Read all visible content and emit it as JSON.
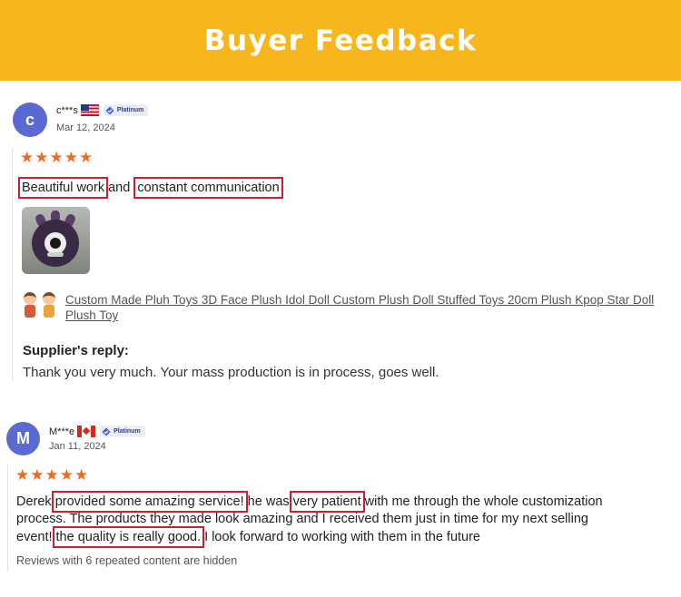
{
  "banner": {
    "title": "Buyer Feedback"
  },
  "reviews": [
    {
      "avatar_letter": "c",
      "name": "c***s",
      "country_flag": "us-flag",
      "badge": "Platinum",
      "date": "Mar 12, 2024",
      "rating": 5,
      "text_parts": [
        "Beautiful work",
        " and ",
        "constant communication"
      ],
      "product_link": "Custom Made Pluh Toys 3D Face Plush Idol Doll Custom Plush Doll Stuffed Toys 20cm Plush Kpop Star Doll Plush Toy",
      "supplier_reply_title": "Supplier's reply:",
      "supplier_reply": "Thank you very much. Your mass production is in process, goes well."
    },
    {
      "avatar_letter": "M",
      "name": "M***e",
      "country_flag": "ca-flag",
      "badge": "Platinum",
      "date": "Jan 11, 2024",
      "rating": 5,
      "text_parts": [
        "Derek ",
        "provided some amazing service!",
        " he was ",
        "very patient",
        " with me through the whole customization",
        "process. The products they made look amazing and I received them just in time for my next selling",
        "event! ",
        "the quality is really good.",
        " I look forward to working with them in the future"
      ],
      "hidden_note": "Reviews with 6 repeated content are hidden"
    }
  ],
  "stars_glyph": "★★★★★",
  "colors": {
    "banner": "#f7b61b",
    "star": "#f06a1a",
    "highlight": "#c8202e",
    "avatar": "#5b6ad0"
  }
}
